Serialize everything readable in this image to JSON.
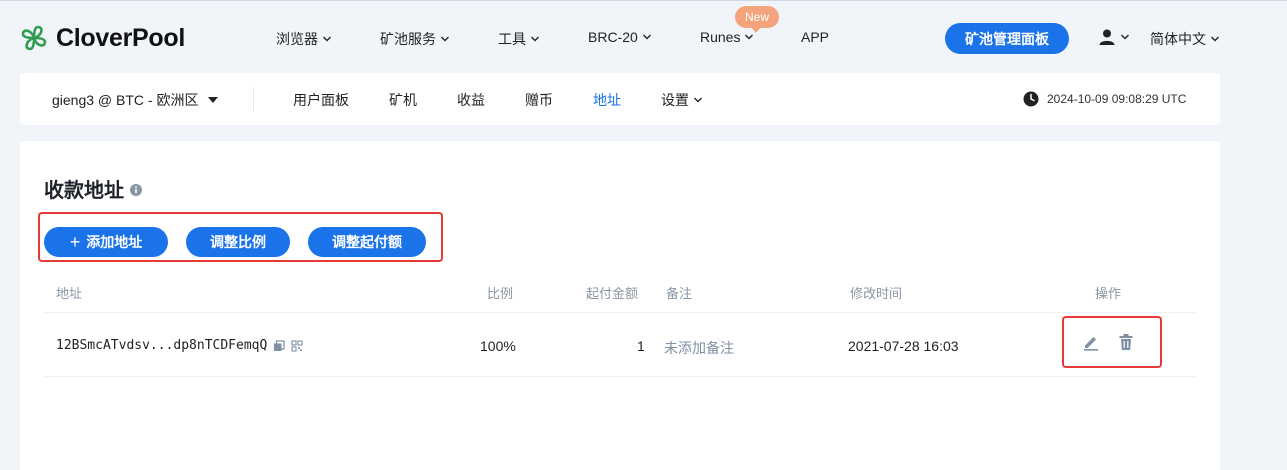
{
  "brand": {
    "name": "CloverPool",
    "logo_icon": "clover-logo-icon",
    "color": "#2e9e4e"
  },
  "top_nav": {
    "items": [
      {
        "label": "浏览器",
        "has_dropdown": true
      },
      {
        "label": "矿池服务",
        "has_dropdown": true
      },
      {
        "label": "工具",
        "has_dropdown": true
      },
      {
        "label": "BRC-20",
        "has_dropdown": true
      },
      {
        "label": "Runes",
        "has_dropdown": true,
        "badge": "New"
      },
      {
        "label": "APP",
        "has_dropdown": false
      }
    ],
    "panel_button": "矿池管理面板",
    "user_icon": "user-icon",
    "language": "简体中文"
  },
  "sub_nav": {
    "account": "gieng3 @ BTC - 欧洲区",
    "items": [
      {
        "label": "用户面板",
        "active": false
      },
      {
        "label": "矿机",
        "active": false
      },
      {
        "label": "收益",
        "active": false
      },
      {
        "label": "赠币",
        "active": false
      },
      {
        "label": "地址",
        "active": true
      },
      {
        "label": "设置",
        "active": false,
        "has_dropdown": true
      }
    ],
    "clock_icon": "clock-icon",
    "time": "2024-10-09 09:08:29 UTC"
  },
  "content": {
    "title": "收款地址",
    "buttons": {
      "add": "添加地址",
      "ratio": "调整比例",
      "threshold": "调整起付额"
    },
    "table": {
      "headers": {
        "address": "地址",
        "ratio": "比例",
        "threshold": "起付金额",
        "note": "备注",
        "modified": "修改时间",
        "actions": "操作"
      },
      "rows": [
        {
          "address": "12BSmcATvdsv...dp8nTCDFemqQ",
          "ratio": "100%",
          "threshold": "1",
          "note": "未添加备注",
          "modified": "2021-07-28 16:03",
          "actions": [
            "edit-icon",
            "trash-icon"
          ]
        }
      ]
    }
  },
  "colors": {
    "accent": "#1a73e8",
    "highlight": "#e53935",
    "badge": "#f4a47c",
    "background": "#f1f5fa"
  }
}
